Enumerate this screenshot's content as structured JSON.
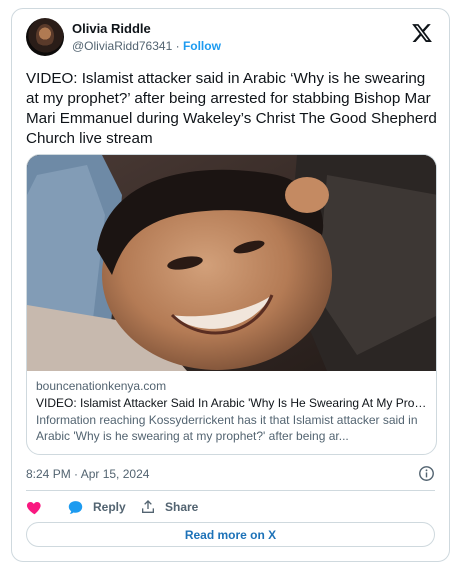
{
  "user": {
    "name": "Olivia Riddle",
    "handle": "@OliviaRidd76341",
    "separator": "·",
    "follow_label": "Follow"
  },
  "tweet": {
    "text": "VIDEO: Islamist attacker said in Arabic ‘Why is he swearing at my prophet?’ after being arrested for stabbing Bishop Mar Mari Emmanuel during Wakeley’s Christ The Good Shepherd Church live stream",
    "timestamp": "8:24 PM · Apr 15, 2024"
  },
  "link_card": {
    "domain": "bouncenationkenya.com",
    "title": "VIDEO: Islamist Attacker Said In Arabic 'Why Is He Swearing At My Prop...",
    "description": "Information reaching Kossyderrickent has it that Islamist attacker said in Arabic 'Why is he swearing at my prophet?' after being ar..."
  },
  "actions": {
    "reply_label": "Reply",
    "share_label": "Share"
  },
  "read_more_label": "Read more on X",
  "icons": {
    "logo": "x-logo-icon",
    "like": "heart-icon",
    "reply": "speech-bubble-icon",
    "share": "share-upload-icon",
    "info": "info-icon"
  },
  "colors": {
    "text": "#0f1419",
    "muted": "#536471",
    "link": "#1d9bf0",
    "border": "#cfd9de",
    "like": "#f91880",
    "reply": "#1d9bf0"
  }
}
